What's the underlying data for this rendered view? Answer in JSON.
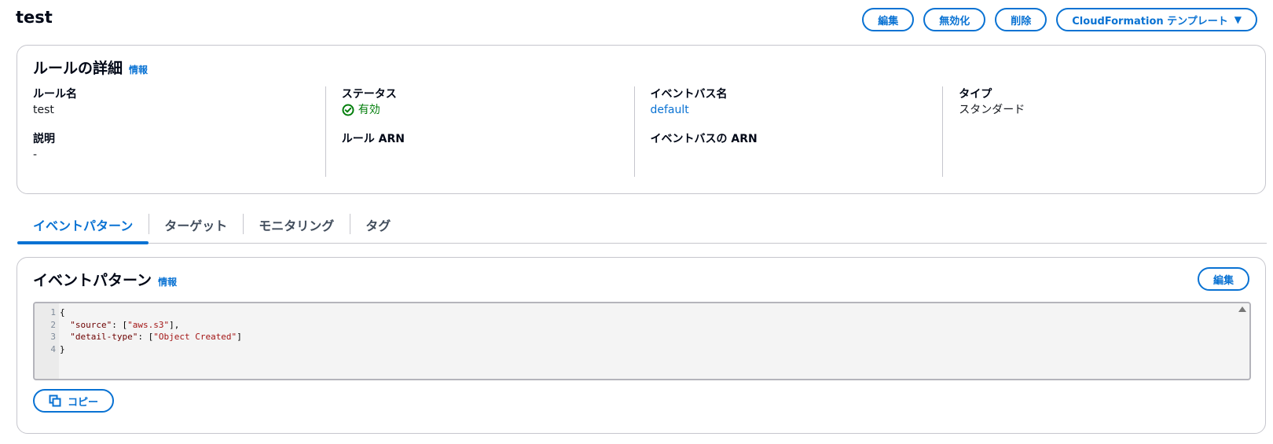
{
  "header": {
    "title": "test",
    "actions": {
      "edit": "編集",
      "disable": "無効化",
      "delete": "削除",
      "cloudformation": "CloudFormation テンプレート"
    }
  },
  "details": {
    "heading": "ルールの詳細",
    "info": "情報",
    "fields": {
      "rule_name_label": "ルール名",
      "rule_name_value": "test",
      "description_label": "説明",
      "description_value": "-",
      "status_label": "ステータス",
      "status_value": "有効",
      "rule_arn_label": "ルール ARN",
      "event_bus_label": "イベントバス名",
      "event_bus_value": "default",
      "event_bus_arn_label": "イベントバスの ARN",
      "type_label": "タイプ",
      "type_value": "スタンダード"
    }
  },
  "tabs": [
    "イベントパターン",
    "ターゲット",
    "モニタリング",
    "タグ"
  ],
  "pattern": {
    "heading": "イベントパターン",
    "info": "情報",
    "edit": "編集",
    "copy": "コピー",
    "lines": [
      {
        "n": "1",
        "text": "{"
      },
      {
        "n": "2",
        "key": "\"source\"",
        "mid": ": [",
        "str": "\"aws.s3\"",
        "end": "],"
      },
      {
        "n": "3",
        "key": "\"detail-type\"",
        "mid": ": [",
        "str": "\"Object Created\"",
        "end": "]"
      },
      {
        "n": "4",
        "text": "}"
      }
    ]
  },
  "colors": {
    "accent": "#0972d3",
    "success": "#037f0c"
  }
}
